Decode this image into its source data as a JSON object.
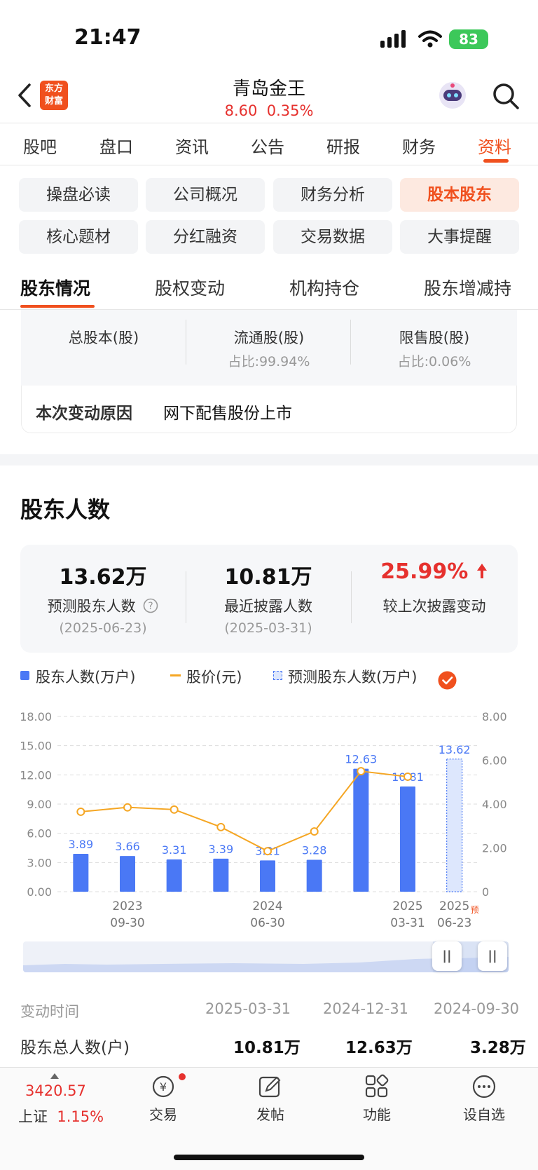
{
  "status_bar": {
    "time": "21:47",
    "battery": "83"
  },
  "header": {
    "logo_line1": "东方",
    "logo_line2": "财富",
    "title": "青岛金王",
    "price": "8.60",
    "change_pct": "0.35%"
  },
  "main_tabs": [
    "股吧",
    "盘口",
    "资讯",
    "公告",
    "研报",
    "财务",
    "资料"
  ],
  "chips": [
    "操盘必读",
    "公司概况",
    "财务分析",
    "股本股东",
    "核心题材",
    "分红融资",
    "交易数据",
    "大事提醒"
  ],
  "sub_tabs": [
    "股东情况",
    "股权变动",
    "机构持仓",
    "股东增减持"
  ],
  "share_structure": {
    "total_label": "总股本(股)",
    "float_label": "流通股(股)",
    "float_ratio": "占比:99.94%",
    "restricted_label": "限售股(股)",
    "restricted_ratio": "占比:0.06%",
    "reason_label": "本次变动原因",
    "reason_value": "网下配售股份上市"
  },
  "holders_section": {
    "title": "股东人数",
    "predicted_value": "13.62万",
    "predicted_label": "预测股东人数",
    "predicted_date": "(2025-06-23)",
    "recent_value": "10.81万",
    "recent_label": "最近披露人数",
    "recent_date": "(2025-03-31)",
    "change_value": "25.99%",
    "change_label": "较上次披露变动"
  },
  "legend": {
    "holders": "股东人数(万户)",
    "price": "股价(元)",
    "predicted": "预测股东人数(万户)"
  },
  "chart_data": {
    "type": "bar",
    "categories": [
      "2023-09-30",
      "",
      "",
      "",
      "2024-06-30",
      "",
      "",
      "2025-03-31",
      "2025-06-23"
    ],
    "x_tick_labels": [
      {
        "index": 1,
        "top": "2023",
        "bottom": "09-30"
      },
      {
        "index": 4,
        "top": "2024",
        "bottom": "06-30"
      },
      {
        "index": 7,
        "top": "2025",
        "bottom": "03-31"
      },
      {
        "index": 8,
        "top": "2025",
        "bottom": "06-23",
        "mark": "预"
      }
    ],
    "series": [
      {
        "name": "股东人数(万户)",
        "values": [
          3.89,
          3.66,
          3.31,
          3.39,
          3.21,
          3.28,
          12.63,
          10.81,
          null
        ],
        "color": "#4a78f5"
      },
      {
        "name": "预测股东人数(万户)",
        "values": [
          null,
          null,
          null,
          null,
          null,
          null,
          null,
          null,
          13.62
        ],
        "color": "#9fb8f7"
      },
      {
        "name": "股价(元)",
        "values": [
          3.65,
          3.85,
          3.75,
          2.95,
          1.85,
          2.75,
          5.5,
          5.25,
          null
        ],
        "color": "#f5a623",
        "axis": "right"
      }
    ],
    "ylim": [
      0,
      18
    ],
    "y_ticks": [
      "0.00",
      "3.00",
      "6.00",
      "9.00",
      "12.00",
      "15.00",
      "18.00"
    ],
    "y2lim": [
      0,
      8
    ],
    "y2_ticks": [
      "0",
      "2.00",
      "4.00",
      "6.00",
      "8.00"
    ],
    "grid": true
  },
  "table": {
    "header_label": "变动时间",
    "dates": [
      "2025-03-31",
      "2024-12-31",
      "2024-09-30"
    ],
    "row_label": "股东总人数(户)",
    "values": [
      "10.81万",
      "12.63万",
      "3.28万"
    ]
  },
  "bottom_nav": {
    "index_value": "3420.57",
    "index_name": "上证",
    "index_change": "1.15%",
    "items": [
      "交易",
      "发帖",
      "功能",
      "设自选"
    ]
  },
  "colors": {
    "accent": "#f0501e",
    "up": "#e6312e",
    "bar": "#4a78f5",
    "line": "#f5a623"
  }
}
